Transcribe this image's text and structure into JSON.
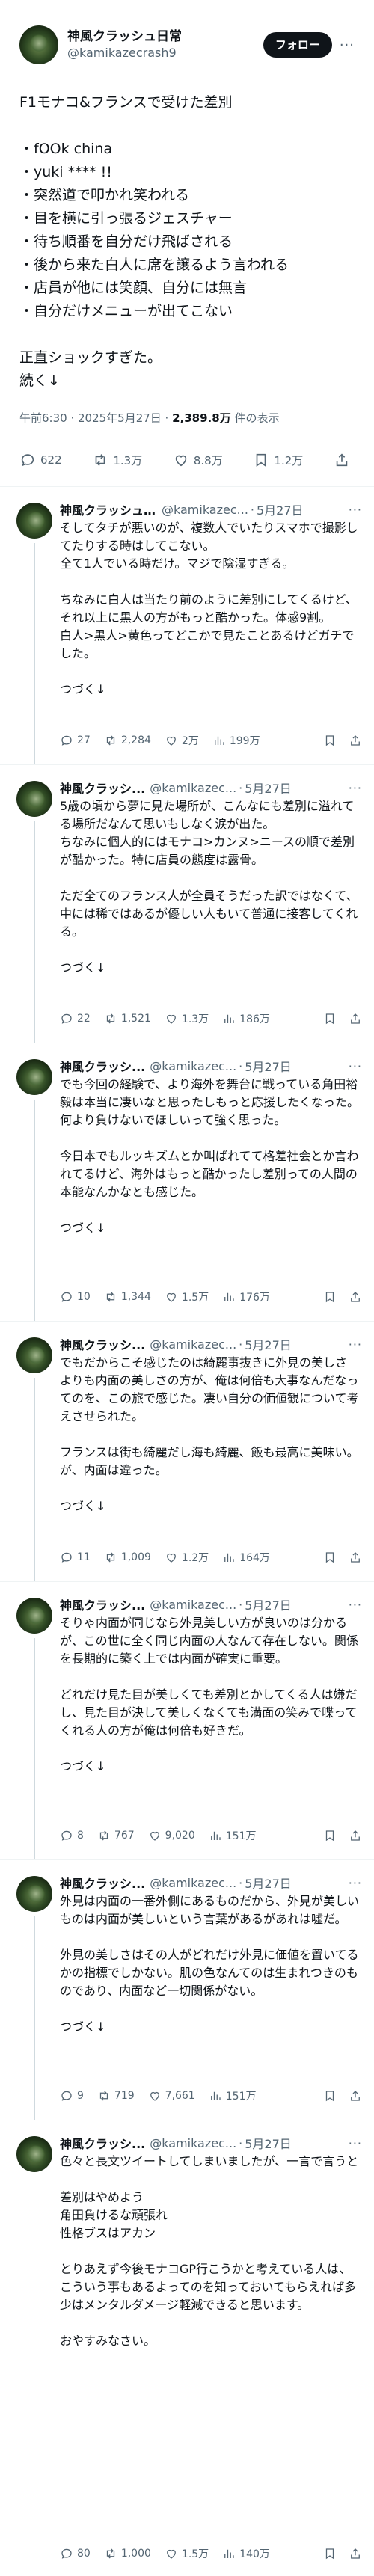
{
  "main": {
    "display_name": "神風クラッシュ日常",
    "handle": "@kamikazecrash9",
    "follow_label": "フォロー",
    "more_icon": "···",
    "text": "F1モナコ&フランスで受けた差別\n\n・fOOk china\n・yuki **** !!\n・突然道で叩かれ笑われる\n・目を横に引っ張るジェスチャー\n・待ち順番を自分だけ飛ばされる\n・後から来た白人に席を譲るよう言われる\n・店員が他には笑顔、自分には無言\n・自分だけメニューが出てこない\n\n正直ショックすぎた。\n続く↓",
    "time": "午前6:30 · 2025年5月27日 · ",
    "views": "2,389.8万",
    "views_suffix": " 件の表示",
    "replies": "622",
    "reposts": "1.3万",
    "likes": "8.8万",
    "bookmarks": "1.2万"
  },
  "replies": [
    {
      "name": "神風クラッシュ...",
      "handle": "@kamikazec...",
      "date": "5月27日",
      "text": "そしてタチが悪いのが、複数人でいたりスマホで撮影してたりする時はしてこない。\n全て1人でいる時だけ。マジで陰湿すぎる。\n\nちなみに白人は当たり前のように差別にしてくるけど、それ以上に黒人の方がもっと酷かった。体感9割。\n白人>黒人>黄色ってどこかで見たことあるけどガチでした。\n\nつづく↓",
      "replies": "27",
      "reposts": "2,284",
      "likes": "2万",
      "views": "199万"
    },
    {
      "name": "神風クラッシ...",
      "handle": "@kamikazec...",
      "date": "5月27日",
      "text": "5歳の頃から夢に見た場所が、こんなにも差別に溢れてる場所だなんて思いもしなく涙が出た。\nちなみに個人的にはモナコ>カンヌ>ニースの順で差別が酷かった。特に店員の態度は露骨。\n\nただ全てのフランス人が全員そうだった訳ではなくて、中には稀ではあるが優しい人もいて普通に接客してくれる。\n\nつづく↓",
      "replies": "22",
      "reposts": "1,521",
      "likes": "1.3万",
      "views": "186万"
    },
    {
      "name": "神風クラッシ...",
      "handle": "@kamikazec...",
      "date": "5月27日",
      "text": "でも今回の経験で、より海外を舞台に戦っている角田裕毅は本当に凄いなと思ったしもっと応援したくなった。何より負けないでほしいって強く思った。\n\n今日本でもルッキズムとか叫ばれてて格差社会とか言われてるけど、海外はもっと酷かったし差別っての人間の本能なんかなとも感じた。\n\nつづく↓",
      "replies": "10",
      "reposts": "1,344",
      "likes": "1.5万",
      "views": "176万"
    },
    {
      "name": "神風クラッシ...",
      "handle": "@kamikazec...",
      "date": "5月27日",
      "text": "でもだからこそ感じたのは綺麗事抜きに外見の美しさよりも内面の美しさの方が、俺は何倍も大事なんだなってのを、この旅で感じた。凄い自分の価値観について考えさせられた。\n\nフランスは街も綺麗だし海も綺麗、飯も最高に美味い。が、内面は違った。\n\nつづく↓",
      "replies": "11",
      "reposts": "1,009",
      "likes": "1.2万",
      "views": "164万"
    },
    {
      "name": "神風クラッシ...",
      "handle": "@kamikazec...",
      "date": "5月27日",
      "text": "そりゃ内面が同じなら外見美しい方が良いのは分かるが、この世に全く同じ内面の人なんて存在しない。関係を長期的に築く上では内面が確実に重要。\n\nどれだけ見た目が美しくても差別とかしてくる人は嫌だし、見た目が決して美しくなくても満面の笑みで喋ってくれる人の方が俺は何倍も好きだ。\n\nつづく↓",
      "replies": "8",
      "reposts": "767",
      "likes": "9,020",
      "views": "151万"
    },
    {
      "name": "神風クラッシ...",
      "handle": "@kamikazec...",
      "date": "5月27日",
      "text": "外見は内面の一番外側にあるものだから、外見が美しいものは内面が美しいという言葉があるがあれは嘘だ。\n\n外見の美しさはその人がどれだけ外見に価値を置いてるかの指標でしかない。肌の色なんてのは生まれつきのものであり、内面など一切関係がない。\n\nつづく↓",
      "replies": "9",
      "reposts": "719",
      "likes": "7,661",
      "views": "151万"
    },
    {
      "name": "神風クラッシ...",
      "handle": "@kamikazec...",
      "date": "5月27日",
      "text": "色々と長文ツイートしてしまいましたが、一言で言うと\n\n差別はやめよう\n角田負けるな頑張れ\n性格ブスはアカン\n\nとりあえず今後モナコGP行こうかと考えている人は、こういう事もあるよってのを知っておいてもらえれば多少はメンタルダメージ軽減できると思います。\n\nおやすみなさい。",
      "replies": "80",
      "reposts": "1,000",
      "likes": "1.5万",
      "views": "140万"
    }
  ],
  "icons": {
    "reply": "reply-icon",
    "repost": "repost-icon",
    "like": "like-icon",
    "views": "views-icon",
    "bookmark": "bookmark-icon",
    "share": "share-icon"
  },
  "colors": {
    "text": "#0f1419",
    "secondary": "#536471",
    "follow_bg": "#0f1419",
    "separator": "#eff3f4",
    "thread_line": "#cfd9de"
  }
}
